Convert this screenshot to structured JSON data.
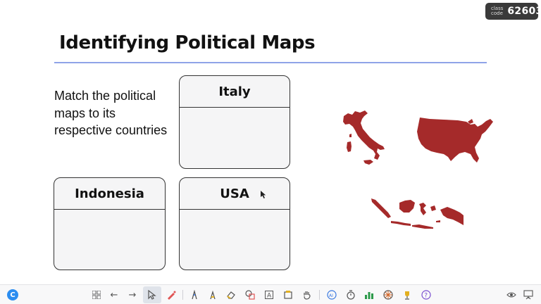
{
  "class_badge": {
    "label": "class code",
    "code": "62603"
  },
  "slide": {
    "title": "Identifying Political Maps",
    "instruction": "Match the political maps to its respective countries",
    "cards": [
      {
        "label": "Italy"
      },
      {
        "label": "Indonesia"
      },
      {
        "label": "USA"
      }
    ],
    "maps": [
      {
        "name": "italy-map-shape"
      },
      {
        "name": "usa-map-shape"
      },
      {
        "name": "indonesia-map-shape"
      }
    ],
    "map_color": "#a52a2a",
    "accent_line_color": "#8fa3e8"
  },
  "toolbar": {
    "logo": "C",
    "icons": [
      "grid-icon",
      "back-arrow-icon",
      "forward-arrow-icon",
      "pointer-icon",
      "laser-pen-icon",
      "pen-icon",
      "highlighter-icon",
      "eraser-icon",
      "shapes-icon",
      "text-icon",
      "sticky-note-icon",
      "hand-raise-icon",
      "ai-icon",
      "timer-icon",
      "poll-chart-icon",
      "spinner-wheel-icon",
      "trophy-icon",
      "help-icon",
      "eye-icon",
      "presenter-icon"
    ]
  }
}
